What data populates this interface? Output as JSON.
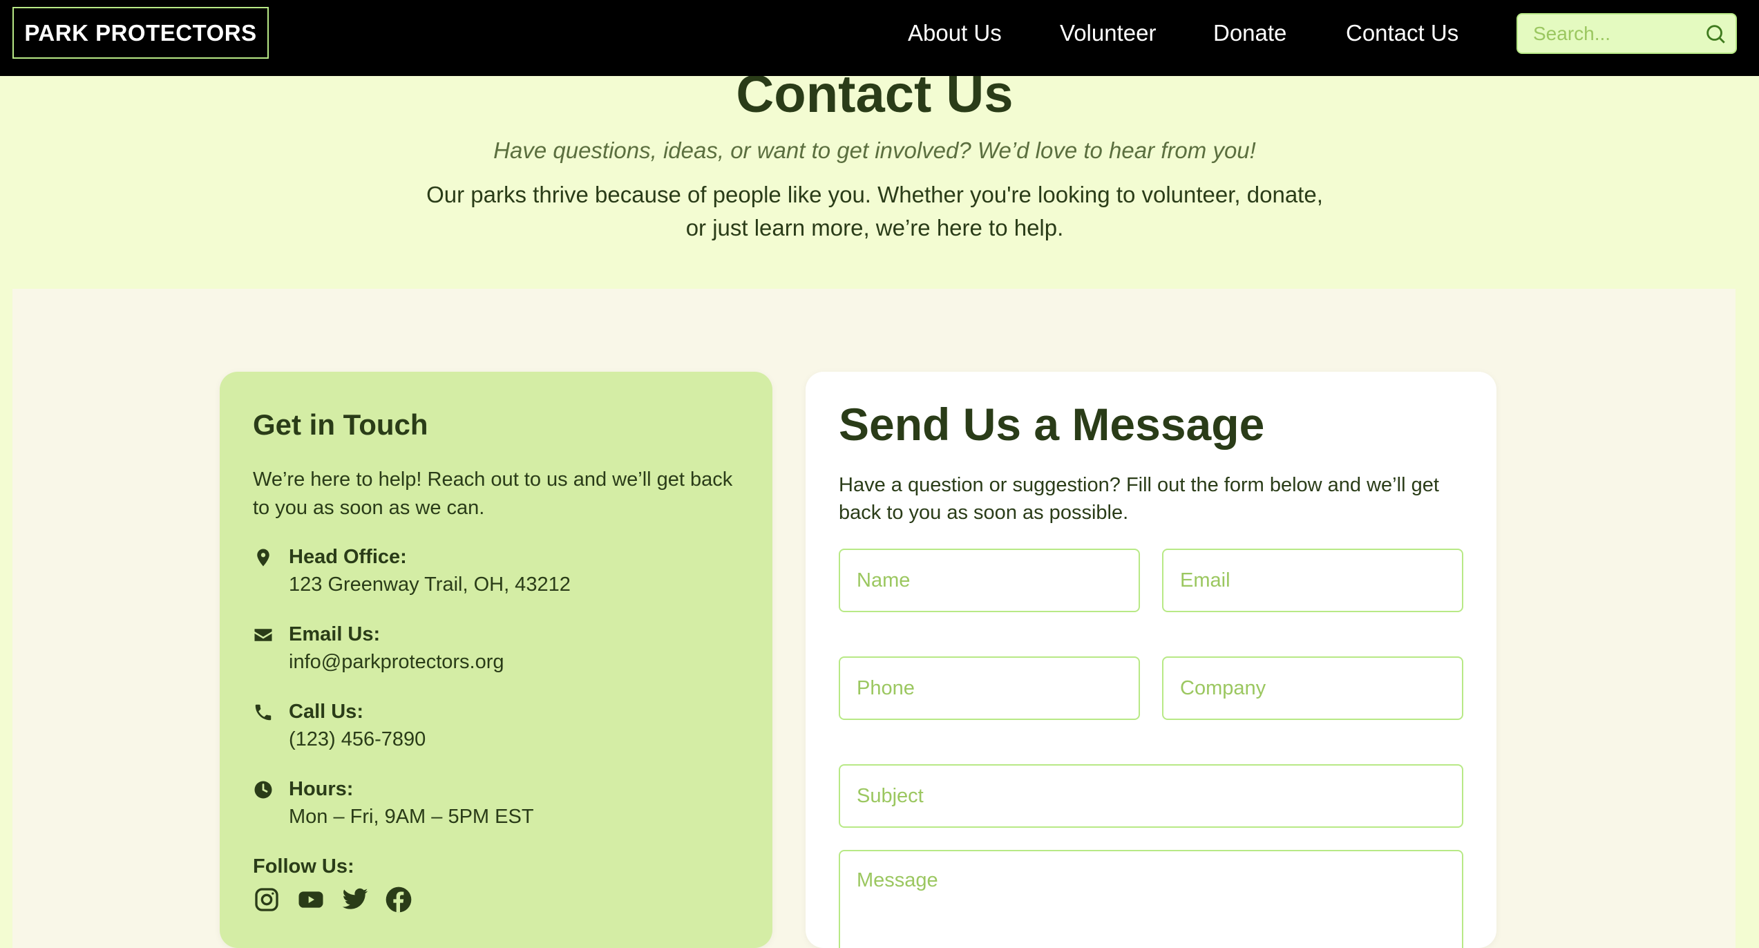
{
  "nav": {
    "logo": "PARK PROTECTORS",
    "links": [
      "About Us",
      "Volunteer",
      "Donate",
      "Contact Us"
    ],
    "search_placeholder": "Search..."
  },
  "hero": {
    "title": "Contact Us",
    "subtitle": "Have questions, ideas, or want to get involved? We’d love to hear from you!",
    "description": "Our parks thrive because of people like you. Whether you're looking to volunteer, donate, or just learn more, we’re here to help."
  },
  "get_in_touch": {
    "title": "Get in Touch",
    "description": "We’re here to help! Reach out to us and we’ll get back to you as soon as we can.",
    "items": [
      {
        "icon": "map-pin-icon",
        "label": "Head Office:",
        "value": "123 Greenway Trail, OH, 43212"
      },
      {
        "icon": "envelope-icon",
        "label": "Email Us:",
        "value": "info@parkprotectors.org"
      },
      {
        "icon": "phone-icon",
        "label": "Call Us:",
        "value": "(123) 456-7890"
      },
      {
        "icon": "clock-icon",
        "label": "Hours:",
        "value": "Mon – Fri, 9AM – 5PM EST"
      }
    ],
    "follow_label": "Follow Us:",
    "socials": [
      "instagram-icon",
      "youtube-icon",
      "twitter-icon",
      "facebook-icon"
    ]
  },
  "form": {
    "title": "Send Us a Message",
    "description": "Have a question or suggestion? Fill out the form below and we’ll get back to you as soon as possible.",
    "placeholders": {
      "name": "Name",
      "email": "Email",
      "phone": "Phone",
      "company": "Company",
      "subject": "Subject",
      "message": "Message"
    }
  },
  "colors": {
    "nav_bg": "#000000",
    "accent": "#b8e986",
    "hero_bg": "#f3fcd2",
    "section_bg": "#f9f7e8",
    "card_left_bg": "#d4eda5",
    "text_dark": "#2a3c18"
  }
}
